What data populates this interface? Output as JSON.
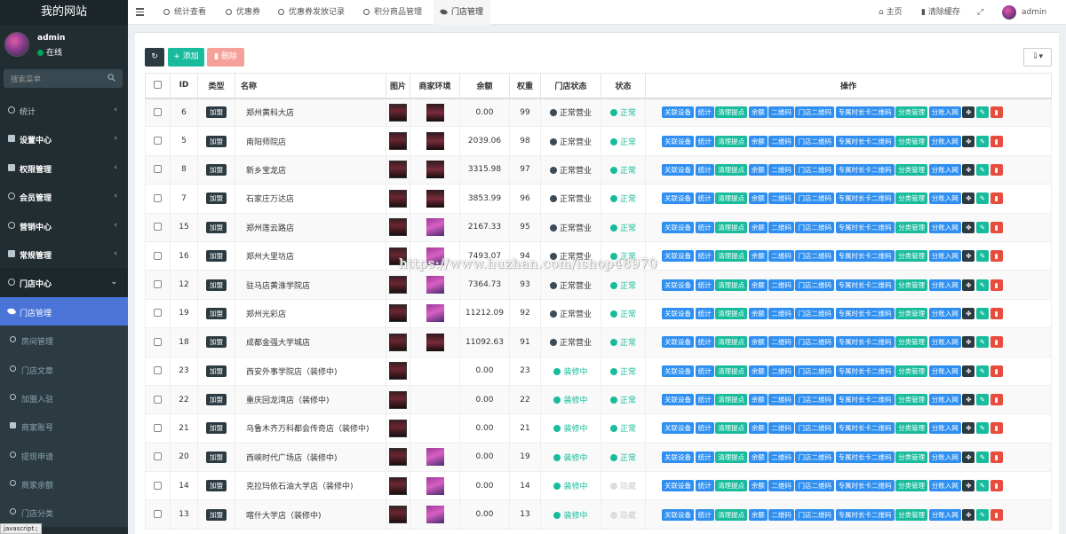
{
  "brand": "我的网站",
  "user": {
    "name": "admin",
    "status": "在线"
  },
  "search": {
    "placeholder": "搜索菜单"
  },
  "menu": [
    {
      "label": "统计",
      "icon": "circle-icon"
    },
    {
      "label": "设置中心",
      "icon": "cogs-icon"
    },
    {
      "label": "权限管理",
      "icon": "group-icon"
    },
    {
      "label": "会员管理",
      "icon": "user-circle-icon"
    },
    {
      "label": "营销中心",
      "icon": "circle-icon"
    },
    {
      "label": "常规管理",
      "icon": "cogs-icon"
    },
    {
      "label": "门店中心",
      "icon": "circle-icon"
    },
    {
      "label": "门店管理",
      "icon": "leaf-icon"
    },
    {
      "label": "房间管理",
      "icon": "circle-icon"
    },
    {
      "label": "门店文章",
      "icon": "circle-icon"
    },
    {
      "label": "加盟入驻",
      "icon": "circle-icon"
    },
    {
      "label": "商家账号",
      "icon": "user-icon"
    },
    {
      "label": "提现申请",
      "icon": "circle-icon"
    },
    {
      "label": "商家余额",
      "icon": "circle-icon"
    },
    {
      "label": "门店分类",
      "icon": "circle-icon"
    }
  ],
  "statusbar": "javascript:;",
  "tabs": [
    "统计查看",
    "优惠券",
    "优惠券发放记录",
    "积分商品管理",
    "门店管理"
  ],
  "topright": {
    "home": "主页",
    "clear_cache": "清除缓存",
    "user": "admin"
  },
  "toolbar": {
    "add": "添加",
    "delete": "删除"
  },
  "table": {
    "headers": [
      "ID",
      "类型",
      "名称",
      "图片",
      "商家环境",
      "余额",
      "权重",
      "门店状态",
      "状态",
      "操作"
    ],
    "type_tag": "加盟",
    "ops": [
      "关联设备",
      "统计",
      "清理提点",
      "余额",
      "二维码",
      "门店二维码",
      "专属时长卡二维码",
      "分类管理",
      "分账入网"
    ],
    "rows": [
      {
        "id": "6",
        "name": "郑州黄科大店",
        "balance": "0.00",
        "weight": "99",
        "store_status": "正常营业",
        "status": "正常"
      },
      {
        "id": "5",
        "name": "南阳师院店",
        "balance": "2039.06",
        "weight": "98",
        "store_status": "正常营业",
        "status": "正常"
      },
      {
        "id": "8",
        "name": "新乡宝龙店",
        "balance": "3315.98",
        "weight": "97",
        "store_status": "正常营业",
        "status": "正常"
      },
      {
        "id": "7",
        "name": "石家庄万达店",
        "balance": "3853.99",
        "weight": "96",
        "store_status": "正常营业",
        "status": "正常"
      },
      {
        "id": "15",
        "name": "郑州莲云路店",
        "balance": "2167.33",
        "weight": "95",
        "store_status": "正常营业",
        "status": "正常"
      },
      {
        "id": "16",
        "name": "郑州大里坊店",
        "balance": "7493.07",
        "weight": "94",
        "store_status": "正常营业",
        "status": "正常"
      },
      {
        "id": "12",
        "name": "驻马店黄淮学院店",
        "balance": "7364.73",
        "weight": "93",
        "store_status": "正常营业",
        "status": "正常"
      },
      {
        "id": "19",
        "name": "郑州光彩店",
        "balance": "11212.09",
        "weight": "92",
        "store_status": "正常营业",
        "status": "正常"
      },
      {
        "id": "18",
        "name": "成都金强大学城店",
        "balance": "11092.63",
        "weight": "91",
        "store_status": "正常营业",
        "status": "正常"
      },
      {
        "id": "23",
        "name": "西安外事学院店（装修中)",
        "balance": "0.00",
        "weight": "23",
        "store_status": "装修中",
        "status": "正常"
      },
      {
        "id": "22",
        "name": "重庆回龙湾店（装修中)",
        "balance": "0.00",
        "weight": "22",
        "store_status": "装修中",
        "status": "正常"
      },
      {
        "id": "21",
        "name": "乌鲁木齐万科都会传奇店（装修中)",
        "balance": "0.00",
        "weight": "21",
        "store_status": "装修中",
        "status": "正常"
      },
      {
        "id": "20",
        "name": "西峡时代广场店（装修中)",
        "balance": "0.00",
        "weight": "19",
        "store_status": "装修中",
        "status": "正常"
      },
      {
        "id": "14",
        "name": "克拉玛依石油大学店（装修中)",
        "balance": "0.00",
        "weight": "14",
        "store_status": "装修中",
        "status": "隐藏"
      },
      {
        "id": "13",
        "name": "喀什大学店（装修中)",
        "balance": "0.00",
        "weight": "13",
        "store_status": "装修中",
        "status": "隐藏"
      }
    ]
  },
  "watermark": "https://www.huzhan.com/ishop48970",
  "colors": {
    "sidebar": "#222d32",
    "active": "#4a74d8",
    "op_button": "#2e8ff0",
    "green": "#18bc9c",
    "danger": "#e74c3c"
  }
}
